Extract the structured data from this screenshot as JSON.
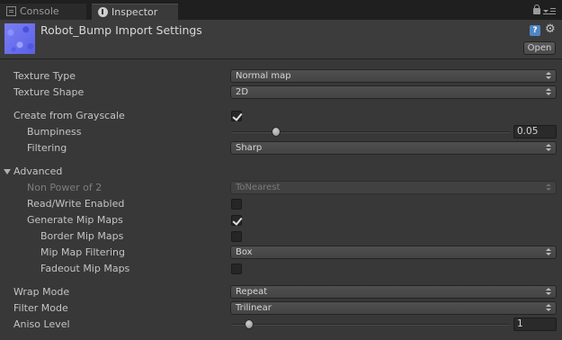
{
  "tabs": [
    {
      "label": "Console"
    },
    {
      "label": "Inspector"
    }
  ],
  "header": {
    "title": "Robot_Bump Import Settings",
    "open_label": "Open",
    "help_glyph": "?"
  },
  "fields": {
    "texture_type": {
      "label": "Texture Type",
      "value": "Normal map"
    },
    "texture_shape": {
      "label": "Texture Shape",
      "value": "2D"
    },
    "create_from_grayscale": {
      "label": "Create from Grayscale",
      "checked": true
    },
    "bumpiness": {
      "label": "Bumpiness",
      "value": "0.05",
      "fraction": 0.16
    },
    "filtering": {
      "label": "Filtering",
      "value": "Sharp"
    },
    "advanced": {
      "label": "Advanced",
      "expanded": true
    },
    "non_power_of_2": {
      "label": "Non Power of 2",
      "value": "ToNearest",
      "disabled": true
    },
    "read_write_enabled": {
      "label": "Read/Write Enabled",
      "checked": false
    },
    "generate_mip_maps": {
      "label": "Generate Mip Maps",
      "checked": true
    },
    "border_mip_maps": {
      "label": "Border Mip Maps",
      "checked": false
    },
    "mip_map_filtering": {
      "label": "Mip Map Filtering",
      "value": "Box"
    },
    "fadeout_mip_maps": {
      "label": "Fadeout Mip Maps",
      "checked": false
    },
    "wrap_mode": {
      "label": "Wrap Mode",
      "value": "Repeat"
    },
    "filter_mode": {
      "label": "Filter Mode",
      "value": "Trilinear"
    },
    "aniso_level": {
      "label": "Aniso Level",
      "value": "1",
      "fraction": 0.063
    }
  },
  "icons": [
    "console-icon",
    "inspector-info-icon",
    "lock-icon",
    "tab-menu-icon",
    "texture-thumbnail",
    "help-icon",
    "gear-icon",
    "foldout-arrow-icon",
    "dropdown-arrows-icon"
  ],
  "colors": {
    "background": "#383838",
    "tabbar": "#1f1f1f",
    "thumbnail": "#6a6ff0",
    "help": "#4f86c6"
  }
}
